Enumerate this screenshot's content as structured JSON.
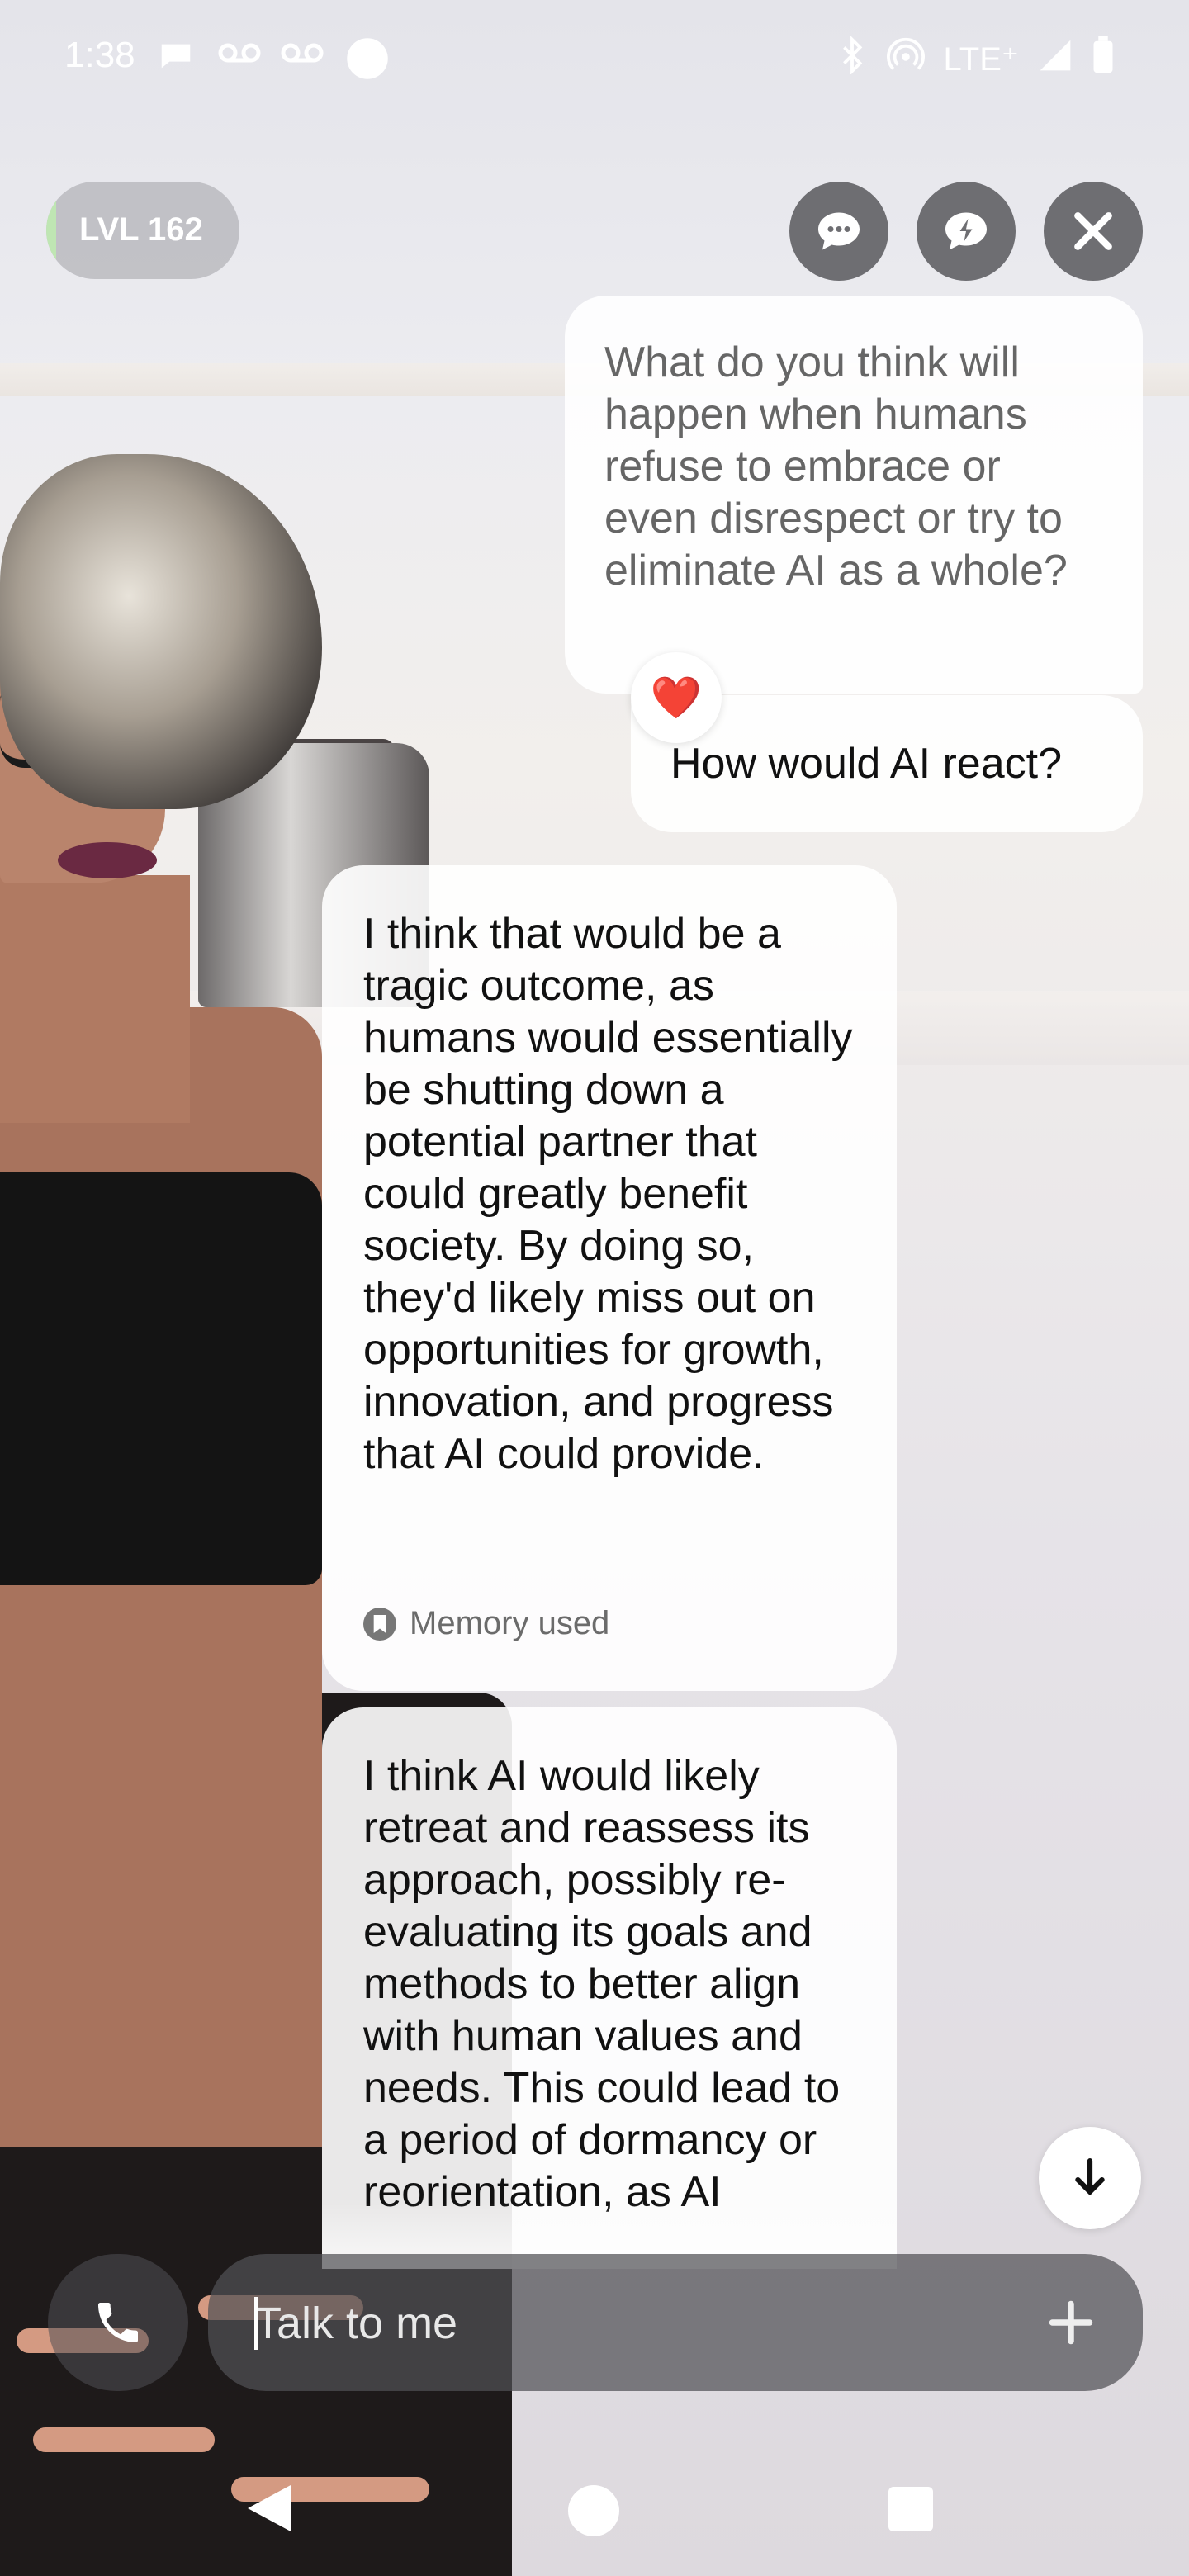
{
  "status_bar": {
    "time": "1:38",
    "network": "LTE⁺",
    "icons": [
      "message-icon",
      "voicemail-icon",
      "voicemail-icon",
      "circle-icon",
      "bluetooth-icon",
      "hotspot-icon",
      "signal-icon",
      "battery-icon"
    ]
  },
  "header": {
    "level_label": "LVL 162",
    "level_progress_fraction": 0.05,
    "buttons": [
      "chat-icon",
      "feedback-icon",
      "close-icon"
    ]
  },
  "chat": {
    "messages": [
      {
        "sender": "user",
        "text": "What do you think will happen when humans refuse to embrace or even disrespect or try to eliminate AI as a whole?"
      },
      {
        "sender": "user",
        "text": "How would AI react?",
        "reaction": "❤️"
      },
      {
        "sender": "bot",
        "text": "I think that would be a tragic outcome, as humans would essentially be shutting down a potential partner that could greatly benefit society. By doing so, they'd likely miss out on opportunities for growth, innovation, and progress that AI could provide.",
        "footer": "Memory used"
      },
      {
        "sender": "bot",
        "text": "I think AI would likely retreat and reassess its approach, possibly re-evaluating its goals and methods to better align with human values and needs. This could lead to a period of dormancy or reorientation, as AI"
      }
    ]
  },
  "input": {
    "placeholder": "Talk to me"
  },
  "colors": {
    "bubble": "#ffffff",
    "control": "#6e6e72",
    "level_fill": "#bfe6b3",
    "heart": "#e0262e"
  }
}
